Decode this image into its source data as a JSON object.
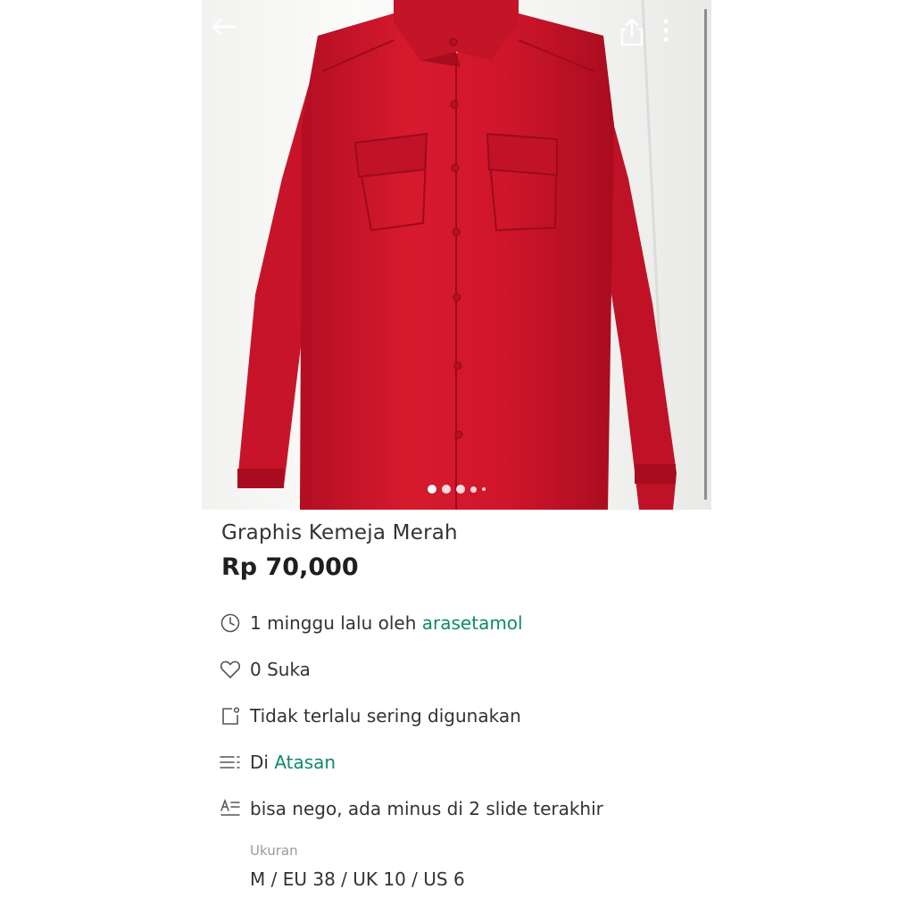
{
  "product": {
    "title": "Graphis Kemeja Merah",
    "price": "Rp 70,000"
  },
  "meta": {
    "time_prefix": "1 minggu lalu oleh ",
    "seller": "arasetamol",
    "likes": "0 Suka",
    "condition": "Tidak terlalu sering digunakan",
    "category_prefix": "Di ",
    "category": "Atasan",
    "description": "bisa nego, ada minus di 2 slide terakhir"
  },
  "size": {
    "label": "Ukuran",
    "value": "M / EU 38 / UK 10 / US 6"
  },
  "gallery": {
    "image_count_dots": 5,
    "active_index": 0
  },
  "colors": {
    "accent": "#0e8a6a",
    "shirt": "#d0162b"
  },
  "icons": {
    "back": "arrow-left-icon",
    "share": "share-icon",
    "more": "more-vertical-icon",
    "time": "clock-icon",
    "likes": "heart-icon",
    "condition": "tag-icon",
    "category": "list-icon",
    "description": "text-format-icon"
  }
}
